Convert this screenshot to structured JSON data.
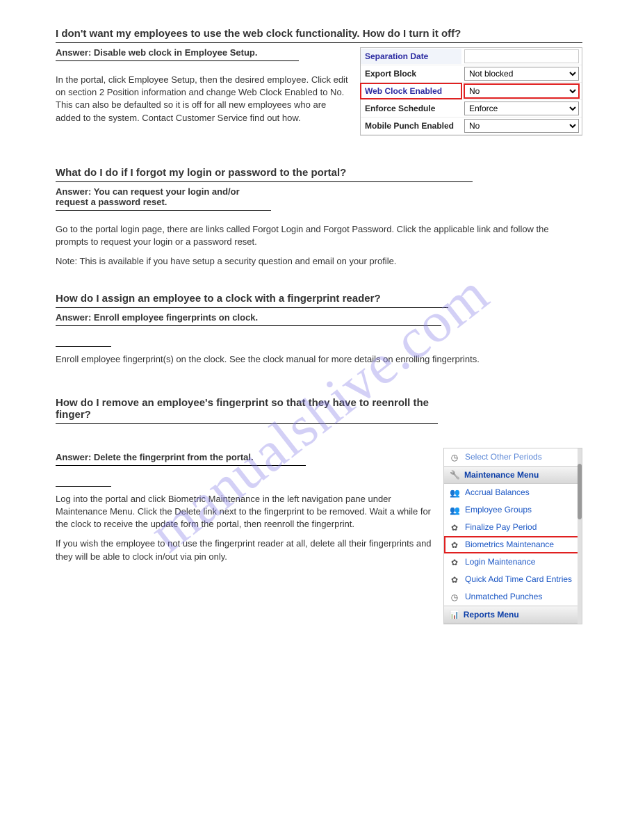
{
  "watermark": "manualshive.com",
  "qa": [
    {
      "question": "I don't want my employees to use the web clock functionality. How do I turn it off?",
      "answer_label": "Answer:",
      "answer": "Disable web clock in Employee Setup.",
      "body": [
        "In the portal, click Employee Setup, then the desired employee. Click edit on section 2 Position information and change Web Clock Enabled to No. This can also be defaulted so it is off for all new employees who are added to the system. Contact Customer Service find out how."
      ]
    },
    {
      "question": "What do I do if I forgot my login or password to the portal?",
      "answer_label": "Answer:",
      "answer": "You can request your login and/or request a password reset.",
      "body": [
        "Go to the portal login page, there are links called Forgot Login and Forgot Password. Click the applicable link and follow the prompts to request your login or a password reset.",
        "Note: This is available if you have setup a security question and email on your profile."
      ]
    },
    {
      "question": "How do I assign an employee to a clock with a fingerprint reader?",
      "answer_label": "Answer:",
      "answer": "Enroll employee fingerprints on clock.",
      "body": [
        "Enroll employee fingerprint(s) on the clock. See the clock manual for more details on enrolling fingerprints."
      ]
    },
    {
      "question": "How do I remove an employee's fingerprint so that they have to reenroll the finger?",
      "answer_label": "Answer:",
      "answer": "Delete the fingerprint from the portal.",
      "body": [
        "Log into the portal and click Biometric Maintenance in the left navigation pane under Maintenance Menu. Click the Delete link next to the fingerprint to be removed. Wait a while for the clock to receive the update form the portal, then reenroll the fingerprint.",
        "If you wish the employee to not use the fingerprint reader at all, delete all their fingerprints and they will be able to clock in/out via pin only."
      ]
    }
  ],
  "form": {
    "rows": [
      {
        "label": "Separation Date",
        "type": "text",
        "value": ""
      },
      {
        "label": "Export Block",
        "type": "select",
        "value": "Not blocked"
      },
      {
        "label": "Web Clock Enabled",
        "type": "select",
        "value": "No",
        "highlight_value": true,
        "highlight_label": true
      },
      {
        "label": "Enforce Schedule",
        "type": "select",
        "value": "Enforce"
      },
      {
        "label": "Mobile Punch Enabled",
        "type": "select",
        "value": "No"
      }
    ]
  },
  "sidebar": {
    "top_item": "Select Other Periods",
    "section1_title": "Maintenance Menu",
    "items": [
      {
        "icon": "users",
        "label": "Accrual Balances"
      },
      {
        "icon": "users",
        "label": "Employee Groups"
      },
      {
        "icon": "gear",
        "label": "Finalize Pay Period"
      },
      {
        "icon": "gear",
        "label": "Biometrics Maintenance",
        "highlight": true
      },
      {
        "icon": "gear",
        "label": "Login Maintenance"
      },
      {
        "icon": "gear",
        "label": "Quick Add Time Card Entries"
      },
      {
        "icon": "clock",
        "label": "Unmatched Punches"
      }
    ],
    "section2_title": "Reports Menu"
  }
}
